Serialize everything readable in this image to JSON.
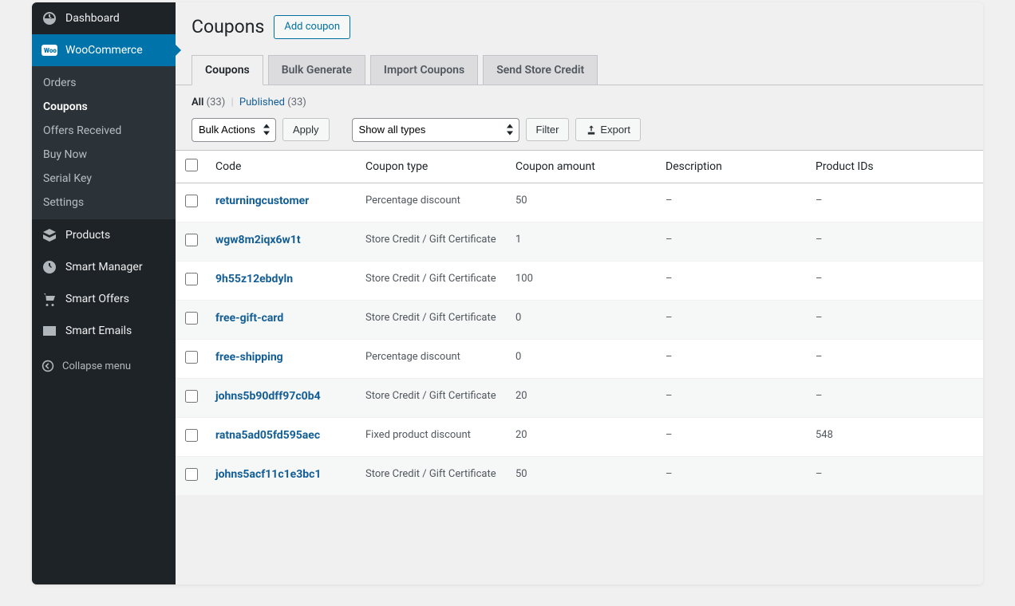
{
  "sidebar": {
    "dashboard": "Dashboard",
    "woocommerce": "WooCommerce",
    "submenu": [
      {
        "label": "Orders",
        "active": false
      },
      {
        "label": "Coupons",
        "active": true
      },
      {
        "label": "Offers Received",
        "active": false
      },
      {
        "label": "Buy Now",
        "active": false
      },
      {
        "label": "Serial Key",
        "active": false
      },
      {
        "label": "Settings",
        "active": false
      }
    ],
    "products": "Products",
    "smart_manager": "Smart Manager",
    "smart_offers": "Smart Offers",
    "smart_emails": "Smart Emails",
    "collapse": "Collapse menu"
  },
  "header": {
    "title": "Coupons",
    "add_button": "Add coupon"
  },
  "tabs": [
    {
      "label": "Coupons",
      "active": true
    },
    {
      "label": "Bulk Generate",
      "active": false
    },
    {
      "label": "Import Coupons",
      "active": false
    },
    {
      "label": "Send Store Credit",
      "active": false
    }
  ],
  "filters": {
    "all_label": "All",
    "all_count": "(33)",
    "published_label": "Published",
    "published_count": "(33)",
    "bulk_actions": "Bulk Actions",
    "apply": "Apply",
    "show_all_types": "Show all types",
    "filter": "Filter",
    "export": "Export"
  },
  "table": {
    "headers": {
      "code": "Code",
      "coupon_type": "Coupon type",
      "coupon_amount": "Coupon amount",
      "description": "Description",
      "product_ids": "Product IDs"
    },
    "rows": [
      {
        "code": "returningcustomer",
        "type": "Percentage discount",
        "amount": "50",
        "description": "–",
        "product_ids": "–"
      },
      {
        "code": "wgw8m2iqx6w1t",
        "type": "Store Credit / Gift Certificate",
        "amount": "1",
        "description": "–",
        "product_ids": "–"
      },
      {
        "code": "9h55z12ebdyln",
        "type": "Store Credit / Gift Certificate",
        "amount": "100",
        "description": "–",
        "product_ids": "–"
      },
      {
        "code": "free-gift-card",
        "type": "Store Credit / Gift Certificate",
        "amount": "0",
        "description": "–",
        "product_ids": "–"
      },
      {
        "code": "free-shipping",
        "type": "Percentage discount",
        "amount": "0",
        "description": "–",
        "product_ids": "–"
      },
      {
        "code": "johns5b90dff97c0b4",
        "type": "Store Credit / Gift Certificate",
        "amount": "20",
        "description": "–",
        "product_ids": "–"
      },
      {
        "code": "ratna5ad05fd595aec",
        "type": "Fixed product discount",
        "amount": "20",
        "description": "–",
        "product_ids": "548"
      },
      {
        "code": "johns5acf11c1e3bc1",
        "type": "Store Credit / Gift Certificate",
        "amount": "50",
        "description": "–",
        "product_ids": "–"
      }
    ]
  }
}
